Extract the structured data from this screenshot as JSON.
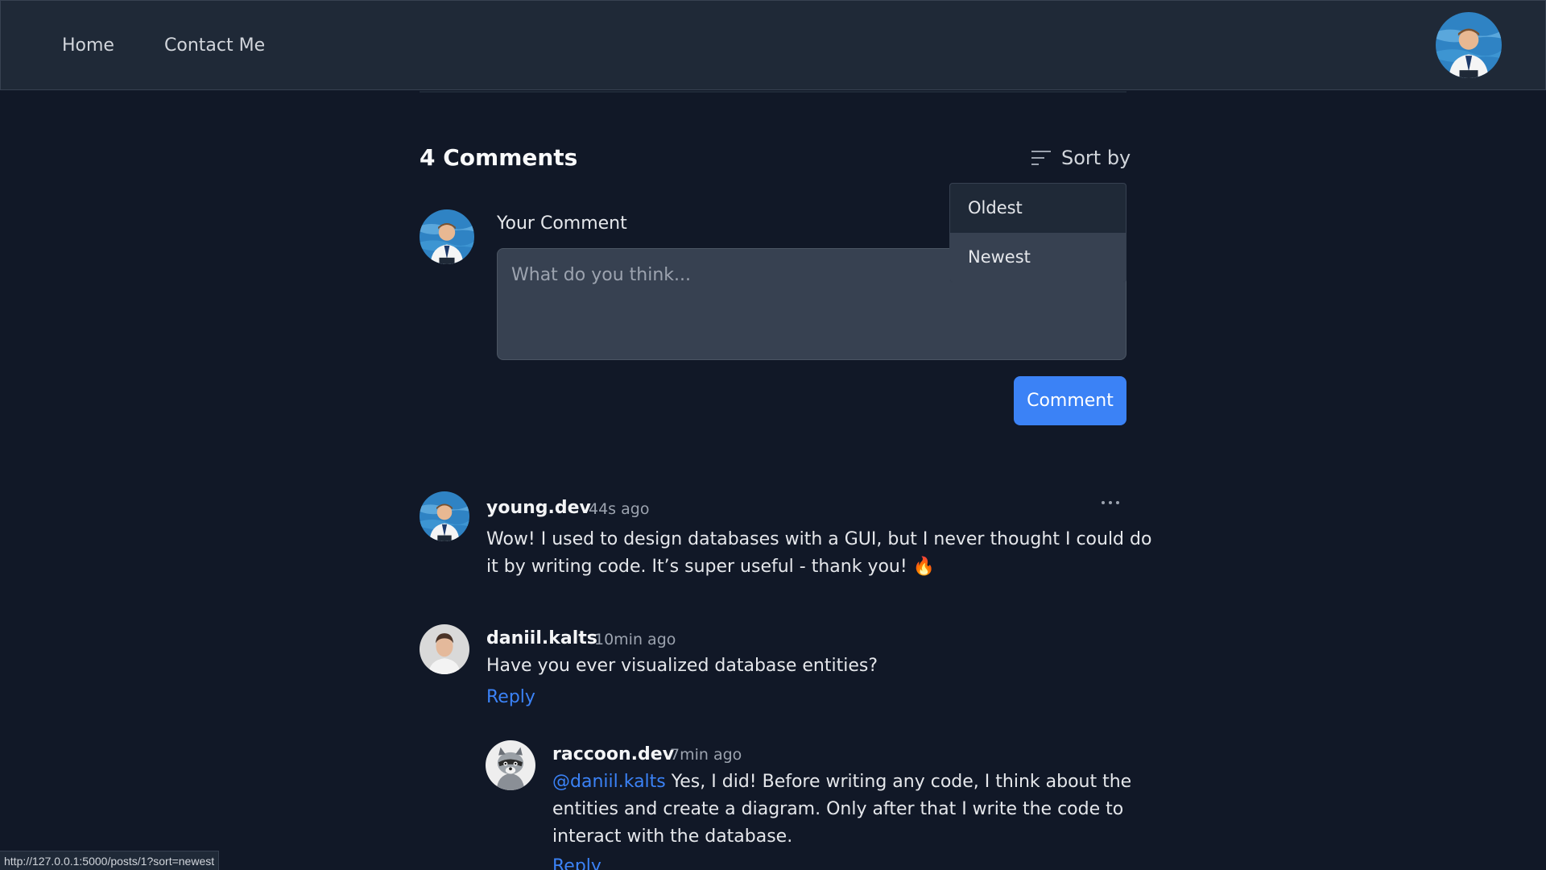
{
  "nav": {
    "home_label": "Home",
    "contact_label": "Contact Me"
  },
  "comments_section": {
    "title": "4 Comments",
    "sort_label": "Sort by",
    "sort_options": [
      "Oldest",
      "Newest"
    ],
    "input_label": "Your Comment",
    "input_placeholder": "What do you think...",
    "submit_label": "Comment"
  },
  "comments": [
    {
      "author": "young.dev",
      "time": "44s ago",
      "text_line1": "Wow! I used to design databases with a GUI, but I never thought I could do",
      "text_line2": "it by writing code. It’s super useful - thank you! 🔥"
    },
    {
      "author": "daniil.kalts",
      "time": "10min ago",
      "text": "Have you ever visualized database entities?",
      "reply_label": "Reply"
    },
    {
      "author": "raccoon.dev",
      "time": "7min ago",
      "mention": "@daniil.kalts",
      "text_line1": " Yes, I did! Before writing any code, I think about the",
      "text_line2": "entities and create a diagram. Only after that I write the code to",
      "text_line3": "interact with the database.",
      "reply_label": "Reply"
    }
  ],
  "status_url": "http://127.0.0.1:5000/posts/1?sort=newest",
  "icons": {
    "sort": "sort-lines-icon",
    "more": "ellipsis-icon"
  },
  "colors": {
    "background": "#111827",
    "header": "#1f2937",
    "accent": "#3b82f6"
  }
}
